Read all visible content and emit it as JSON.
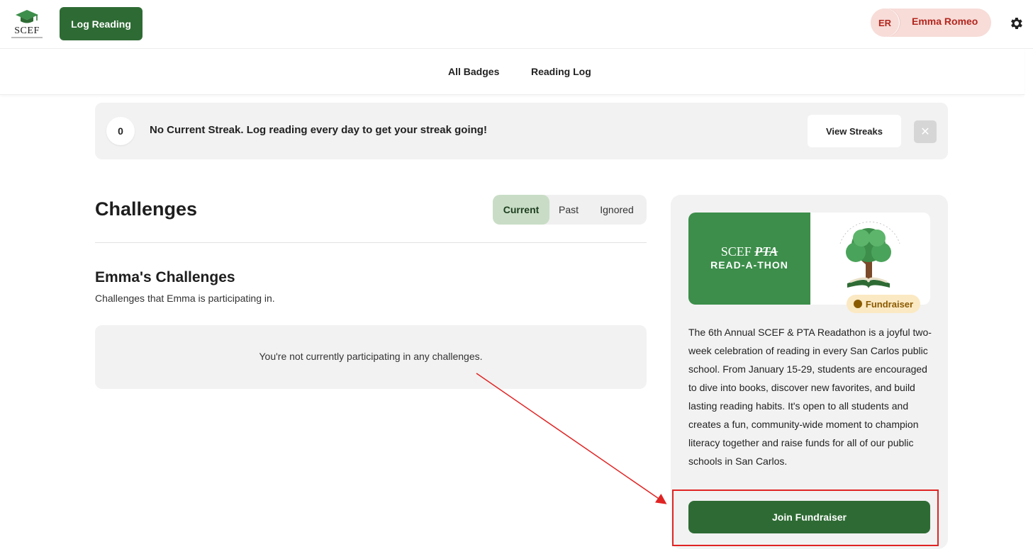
{
  "header": {
    "logo_text": "SCEF",
    "log_reading_label": "Log Reading",
    "user_initials": "ER",
    "user_name": "Emma Romeo"
  },
  "subnav": {
    "all_badges": "All Badges",
    "reading_log": "Reading Log"
  },
  "streak": {
    "count": "0",
    "message": "No Current Streak. Log reading every day to get your streak going!",
    "view_label": "View Streaks",
    "close_glyph": "✕"
  },
  "challenges": {
    "title": "Challenges",
    "tabs": [
      {
        "label": "Current",
        "active": true
      },
      {
        "label": "Past",
        "active": false
      },
      {
        "label": "Ignored",
        "active": false
      }
    ],
    "section_title": "Emma's Challenges",
    "section_subtitle": "Challenges that Emma is participating in.",
    "empty_text": "You're not currently participating in any challenges."
  },
  "fundraiser_card": {
    "banner_line1_prefix": "SCEF",
    "banner_line1_logo": "PTA",
    "banner_line2": "READ-A-THON",
    "badge_label": "Fundraiser",
    "description": "The 6th Annual SCEF & PTA Readathon is a joyful two-week celebration of reading in every San Carlos public school. From January 15-29, students are encouraged to dive into books, discover new favorites, and build lasting reading habits. It's open to all students and creates a fun, community-wide moment to champion literacy together and raise funds for all of our public schools in San Carlos.",
    "join_label": "Join Fundraiser"
  },
  "colors": {
    "brand_green": "#2e6b34",
    "banner_green": "#3c8e4a",
    "user_pill": "#f7dcd8",
    "user_text": "#b3261e",
    "annotation_red": "#e02424",
    "badge_bg": "#fbe9c3"
  }
}
